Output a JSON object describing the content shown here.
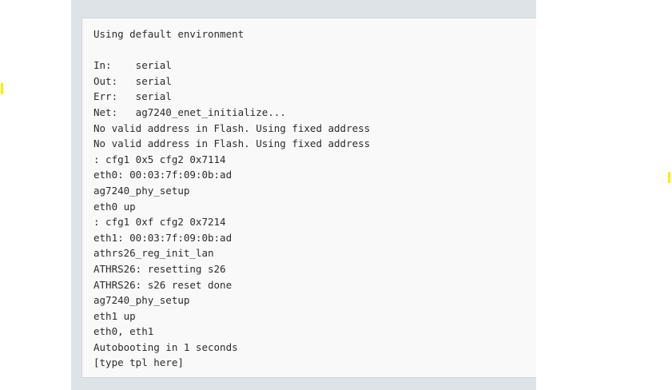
{
  "console": {
    "lines": [
      "Using default environment",
      "",
      "In:    serial",
      "Out:   serial",
      "Err:   serial",
      "Net:   ag7240_enet_initialize...",
      "No valid address in Flash. Using fixed address",
      "No valid address in Flash. Using fixed address",
      ": cfg1 0x5 cfg2 0x7114",
      "eth0: 00:03:7f:09:0b:ad",
      "ag7240_phy_setup",
      "eth0 up",
      ": cfg1 0xf cfg2 0x7214",
      "eth1: 00:03:7f:09:0b:ad",
      "athrs26_reg_init_lan",
      "ATHRS26: resetting s26",
      "ATHRS26: s26 reset done",
      "ag7240_phy_setup",
      "eth1 up",
      "eth0, eth1",
      "Autobooting in 1 seconds",
      "[type tpl here]"
    ],
    "highlight_color": "#ffea00"
  }
}
